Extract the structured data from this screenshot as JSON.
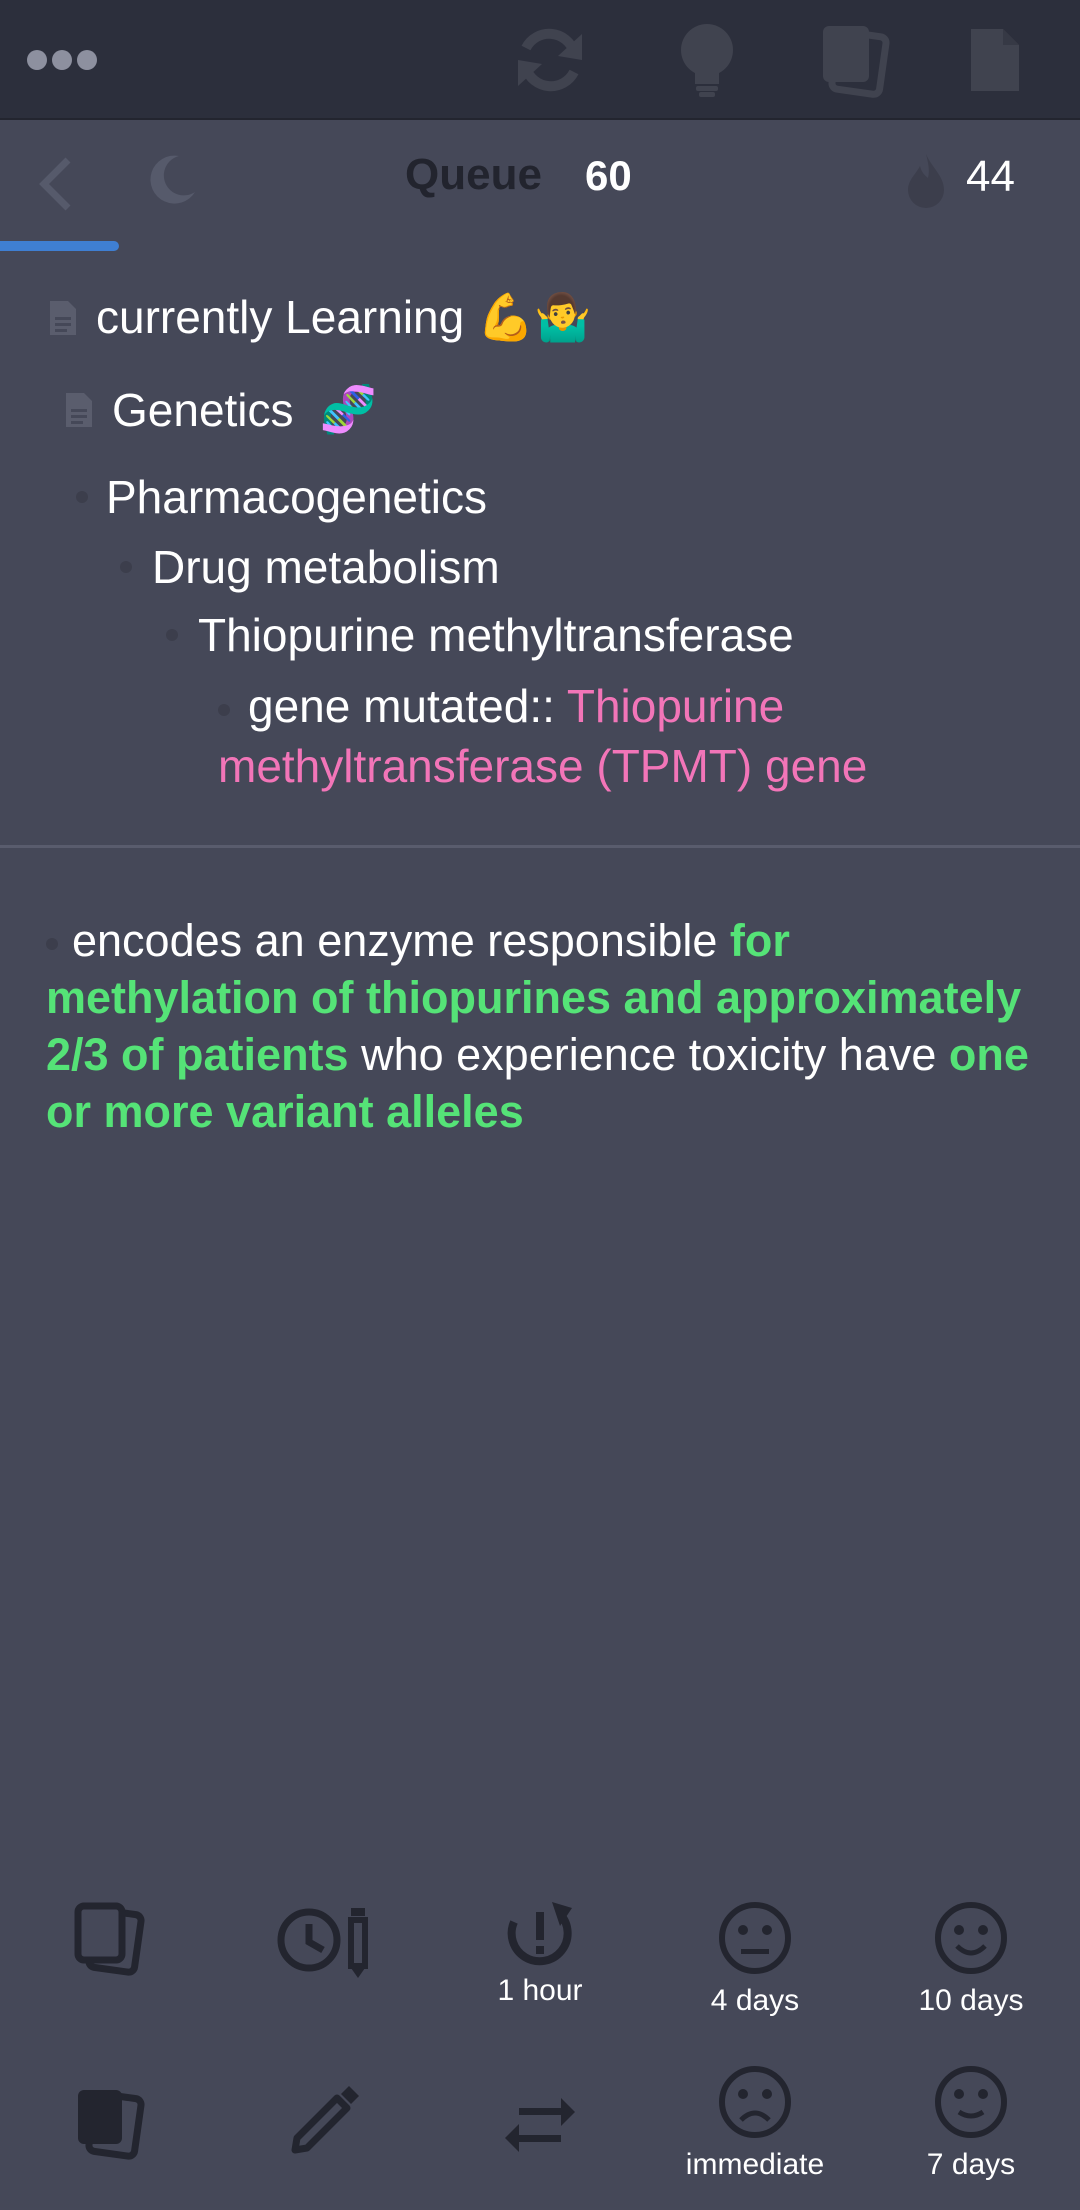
{
  "topbar": {
    "icons": [
      "more-dots-icon",
      "sync-icon",
      "lightbulb-icon",
      "cards-icon",
      "document-icon"
    ]
  },
  "subbar": {
    "queue_label": "Queue",
    "queue_count": "60",
    "streak_count": "44",
    "progress_fraction": 0.11
  },
  "breadcrumb": {
    "root": "currently Learning 💪🤷‍♂️",
    "page": "Genetics",
    "page_emoji": "🧬",
    "level1": "Pharmacogenetics",
    "level2": "Drug metabolism",
    "level3": "Thiopurine methyltransferase",
    "question_prefix": "gene mutated::",
    "question_answer": "Thiopurine methyltransferase (TPMT) gene"
  },
  "answer": {
    "part1": "encodes an enzyme responsible ",
    "part2": "for methylation of thiopurines and approximately 2/3 of patients",
    "part3": " who experience toxicity have ",
    "part4": "one or more variant alleles"
  },
  "controls": {
    "row1": [
      {
        "icon": "cards-outline-icon",
        "label": ""
      },
      {
        "icon": "clock-pencil-icon",
        "label": ""
      },
      {
        "icon": "reset-icon",
        "label": "1 hour"
      },
      {
        "icon": "neutral-face-icon",
        "label": "4 days"
      },
      {
        "icon": "smile-face-icon",
        "label": "10 days"
      }
    ],
    "row2": [
      {
        "icon": "cards-filled-icon",
        "label": ""
      },
      {
        "icon": "pencil-icon",
        "label": ""
      },
      {
        "icon": "swap-icon",
        "label": ""
      },
      {
        "icon": "sad-face-icon",
        "label": "immediate"
      },
      {
        "icon": "slight-smile-icon",
        "label": "7 days"
      }
    ]
  }
}
